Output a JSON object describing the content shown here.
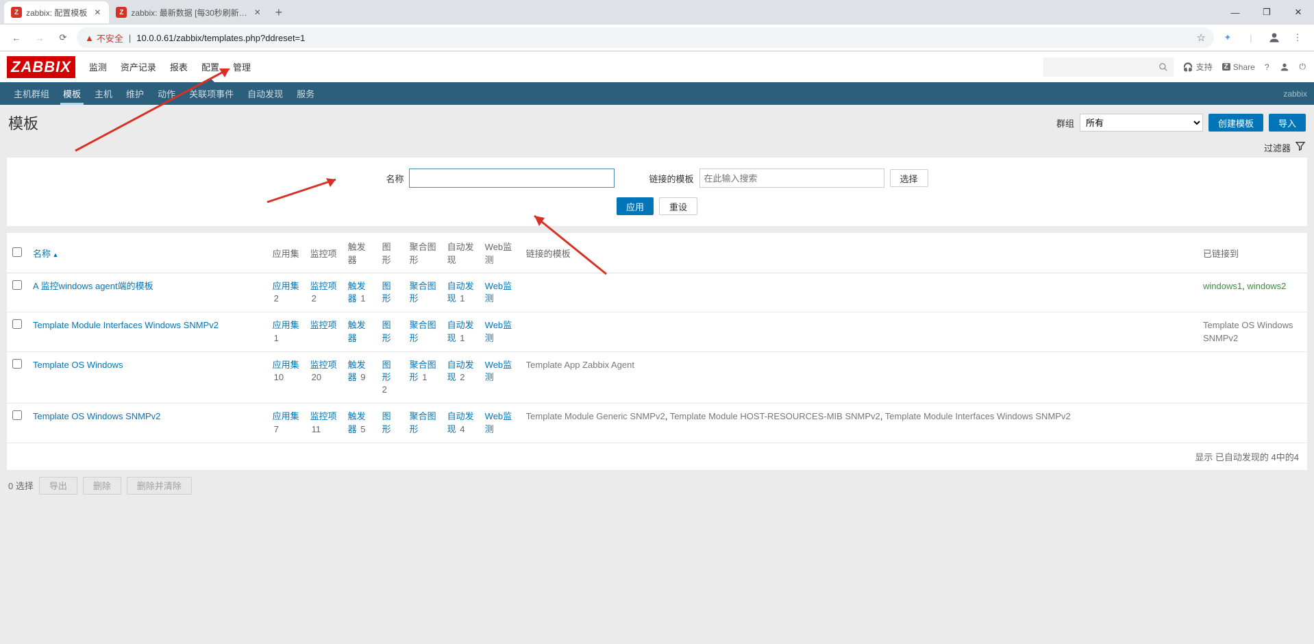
{
  "browser": {
    "tabs": [
      {
        "title": "zabbix: 配置模板",
        "active": true
      },
      {
        "title": "zabbix: 最新数据 [每30秒刷新…",
        "active": false
      }
    ],
    "not_secure": "不安全",
    "url": "10.0.0.61/zabbix/templates.php?ddreset=1"
  },
  "topnav": [
    "监测",
    "资产记录",
    "报表",
    "配置",
    "管理"
  ],
  "top_active": 3,
  "share_label": "Share",
  "support_label": "支持",
  "subnav": [
    "主机群组",
    "模板",
    "主机",
    "维护",
    "动作",
    "关联项事件",
    "自动发现",
    "服务"
  ],
  "sub_active": 1,
  "sub_right": "zabbix",
  "page_title": "模板",
  "group_label": "群组",
  "group_value": "所有",
  "btn_create": "创建模板",
  "btn_import": "导入",
  "filter_tab": "过滤器",
  "filter": {
    "name_label": "名称",
    "linked_label": "链接的模板",
    "linked_placeholder": "在此输入搜索",
    "select_btn": "选择",
    "apply": "应用",
    "reset": "重设"
  },
  "cols": {
    "name": "名称",
    "apps": "应用集",
    "items": "监控项",
    "triggers": "触发器",
    "graphs": "图形",
    "screens": "聚合图形",
    "discovery": "自动发现",
    "web": "Web监测",
    "linked_tpl": "链接的模板",
    "linked_to": "已链接到"
  },
  "rows": [
    {
      "name": "A 监控windows agent端的模板",
      "apps": "2",
      "items": "2",
      "triggers": "1",
      "graphs": "",
      "screens": "",
      "discovery": "1",
      "web": "",
      "linked_tpl": "",
      "linked_to": [
        {
          "text": "windows1",
          "cls": "green"
        },
        {
          "text": "windows2",
          "cls": "green"
        }
      ]
    },
    {
      "name": "Template Module Interfaces Windows SNMPv2",
      "apps": "1",
      "items": "",
      "triggers": "",
      "graphs": "",
      "screens": "",
      "discovery": "1",
      "web": "",
      "linked_tpl": "",
      "linked_to": [
        {
          "text": "Template OS Windows SNMPv2",
          "cls": "grey"
        }
      ]
    },
    {
      "name": "Template OS Windows",
      "apps": "10",
      "items": "20",
      "triggers": "9",
      "graphs": "2",
      "screens": "1",
      "discovery": "2",
      "web": "",
      "linked_tpl": [
        {
          "text": "Template App Zabbix Agent"
        }
      ],
      "linked_to": []
    },
    {
      "name": "Template OS Windows SNMPv2",
      "apps": "7",
      "items": "11",
      "triggers": "5",
      "graphs": "",
      "screens": "",
      "discovery": "4",
      "web": "",
      "linked_tpl": [
        {
          "text": "Template Module Generic SNMPv2"
        },
        {
          "text": "Template Module HOST-RESOURCES-MIB SNMPv2"
        },
        {
          "text": "Template Module Interfaces Windows SNMPv2"
        }
      ],
      "linked_to": []
    }
  ],
  "footer": "显示 已自动发现的 4中的4",
  "bottom": {
    "selected": "0 选择",
    "export": "导出",
    "delete": "删除",
    "delete_clear": "删除并清除"
  }
}
